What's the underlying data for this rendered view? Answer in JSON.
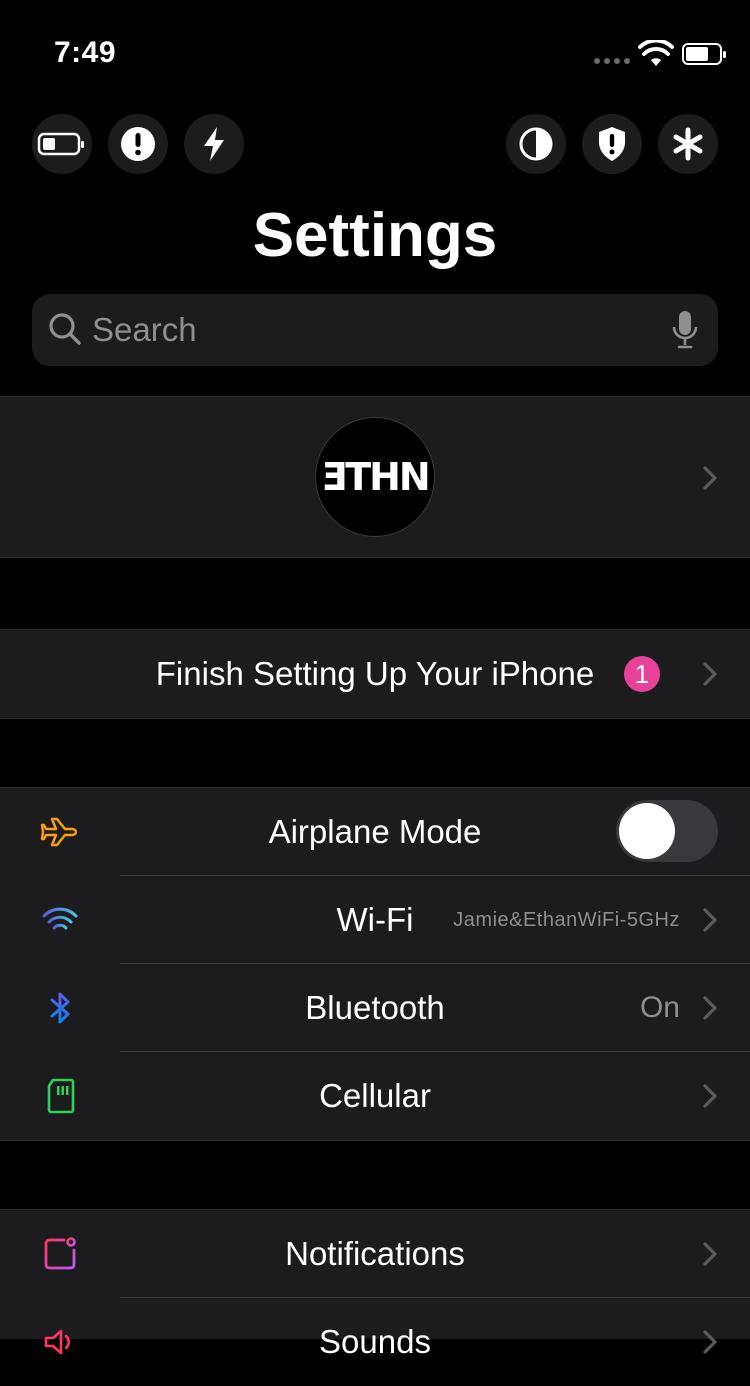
{
  "status_bar": {
    "time": "7:49"
  },
  "quick_actions": [
    {
      "icon": "battery-icon"
    },
    {
      "icon": "alert-icon"
    },
    {
      "icon": "bolt-icon"
    },
    {
      "icon": "contrast-icon"
    },
    {
      "icon": "shield-alert-icon"
    },
    {
      "icon": "asterisk-icon"
    }
  ],
  "title": "Settings",
  "search": {
    "placeholder": "Search",
    "value": ""
  },
  "profile": {
    "avatar_text": "ƎTHN"
  },
  "setup": {
    "label": "Finish Setting Up Your iPhone",
    "badge": "1"
  },
  "connectivity": [
    {
      "label": "Airplane Mode",
      "icon": "airplane-icon",
      "color": "#ff9f0a",
      "toggle": "off"
    },
    {
      "label": "Wi-Fi",
      "detail": "Jamie&EthanWiFi-5GHz",
      "icon": "wifi-icon",
      "color": "#0a84ff"
    },
    {
      "label": "Bluetooth",
      "detail": "On",
      "icon": "bluetooth-icon",
      "color": "#0a84ff"
    },
    {
      "label": "Cellular",
      "icon": "cellular-icon",
      "color": "#30d158"
    }
  ],
  "general": [
    {
      "label": "Notifications",
      "icon": "notifications-icon",
      "color": "#ff375f"
    },
    {
      "label": "Sounds",
      "icon": "sounds-icon",
      "color": "#ff375f"
    }
  ],
  "colors": {
    "background": "#000000",
    "cell": "#1c1c1e",
    "secondary_text": "#8e8e93",
    "badge": "#e8419a"
  }
}
